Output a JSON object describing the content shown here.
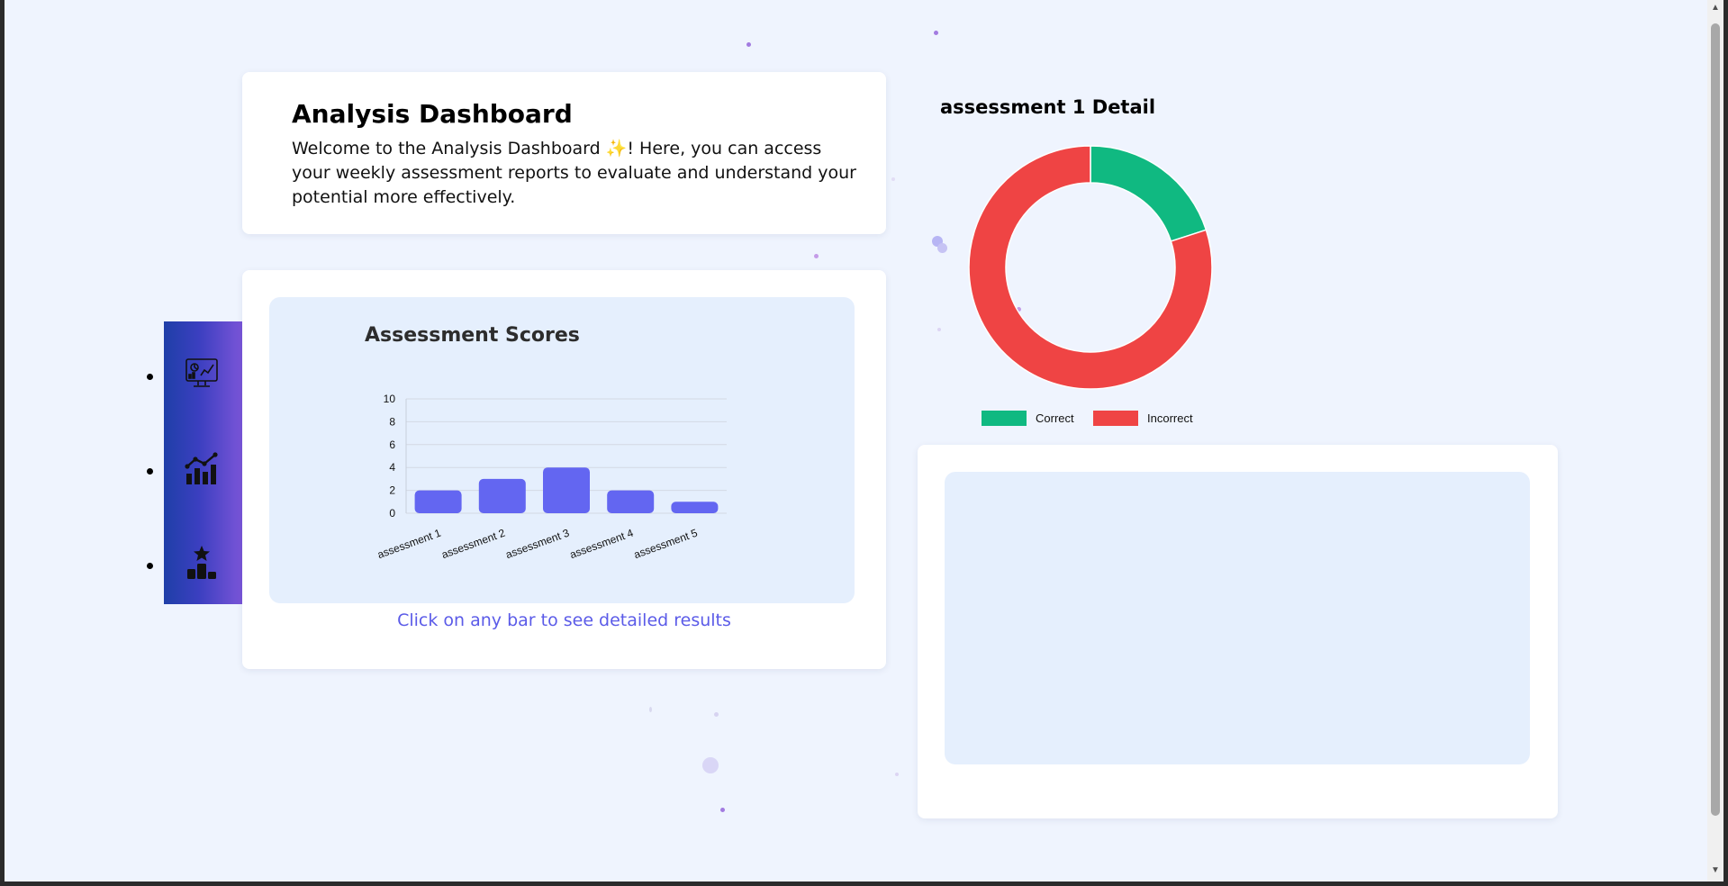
{
  "intro": {
    "title": "Analysis Dashboard",
    "text": "Welcome to the Analysis Dashboard ✨! Here, you can access your weekly assessment reports to evaluate and understand your potential more effectively."
  },
  "sidebar": {
    "items": [
      {
        "icon": "monitor-analytics-icon"
      },
      {
        "icon": "line-bar-chart-icon"
      },
      {
        "icon": "podium-star-icon"
      }
    ]
  },
  "scores_panel": {
    "title": "Assessment Scores",
    "hint": "Click on any bar to see detailed results"
  },
  "detail_panel": {
    "title": "assessment 1 Detail"
  },
  "colors": {
    "bar": "#6366f1",
    "correct": "#10b981",
    "incorrect": "#ef4444",
    "hint_text": "#5b5be8"
  },
  "chart_data": [
    {
      "type": "bar",
      "categories": [
        "assessment 1",
        "assessment 2",
        "assessment 3",
        "assessment 4",
        "assessment 5"
      ],
      "values": [
        2,
        3,
        4,
        2,
        1
      ],
      "title": "Assessment Scores",
      "xlabel": "",
      "ylabel": "",
      "ylim": [
        0,
        10
      ],
      "yticks": [
        0,
        2,
        4,
        6,
        8,
        10
      ],
      "grid": true
    },
    {
      "type": "pie",
      "donut": true,
      "title": "assessment 1 Detail",
      "labels": [
        "Correct",
        "Incorrect"
      ],
      "values": [
        2,
        8
      ],
      "colors": [
        "#10b981",
        "#ef4444"
      ],
      "legend": "bottom"
    }
  ]
}
